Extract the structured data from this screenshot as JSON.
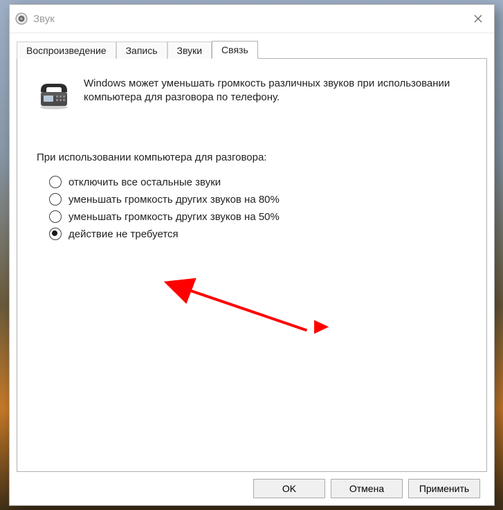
{
  "window": {
    "title": "Звук"
  },
  "tabs": [
    {
      "label": "Воспроизведение",
      "active": false
    },
    {
      "label": "Запись",
      "active": false
    },
    {
      "label": "Звуки",
      "active": false
    },
    {
      "label": "Связь",
      "active": true
    }
  ],
  "intro": {
    "text": "Windows может уменьшать громкость различных звуков при использовании компьютера для разговора по телефону."
  },
  "group": {
    "label": "При использовании компьютера для разговора:"
  },
  "options": [
    {
      "label": "отключить все остальные звуки",
      "checked": false
    },
    {
      "label": "уменьшать громкость других звуков на 80%",
      "checked": false
    },
    {
      "label": "уменьшать громкость других звуков на 50%",
      "checked": false
    },
    {
      "label": "действие не требуется",
      "checked": true
    }
  ],
  "buttons": {
    "ok": "OK",
    "cancel": "Отмена",
    "apply": "Применить"
  }
}
